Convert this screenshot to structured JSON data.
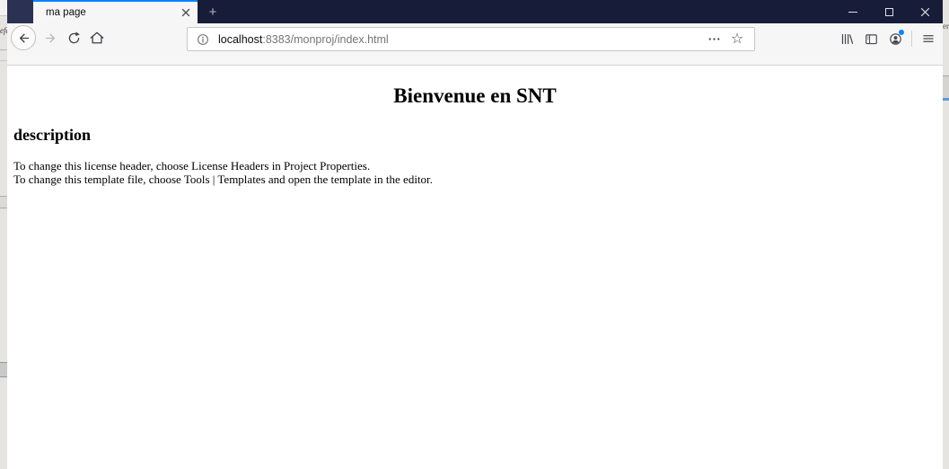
{
  "browser": {
    "tab_bar": {
      "active_tab_title": "ma page",
      "close_tab_glyph": "✕",
      "new_tab_glyph": "+"
    },
    "window_controls": {
      "minimize": "minimize",
      "maximize": "maximize",
      "close": "close"
    },
    "urlbar": {
      "host": "localhost",
      "path": ":8383/monproj/index.html",
      "bookmark_star_glyph": "☆"
    }
  },
  "page": {
    "title": "Bienvenue en SNT",
    "section_heading": "description",
    "paragraph_lines": [
      "To change this license header, choose License Headers in Project Properties.",
      "To change this template file, choose Tools | Templates and open the template in the editor."
    ]
  },
  "background_windows": {
    "left_edge_text": "efa",
    "right_edge_text": "er"
  },
  "colors": {
    "titlebar_bg": "#171c38",
    "titlebar_spacer": "#2b3153",
    "tab_accent_blue": "#0a84ff",
    "toolbar_bg": "#f6f6f7",
    "account_badge_blue": "#0a84ff",
    "url_host_color": "#0c0c0d",
    "url_path_color": "#757575",
    "icon_color": "#47484d",
    "disabled_icon_color": "#b8b8ba"
  },
  "icons": {
    "back": "left-arrow-in-circle",
    "forward": "right-arrow (disabled)",
    "reload": "circular-arrow",
    "home": "house-outline",
    "info": "i-in-circle",
    "page_actions": "three-dots",
    "bookmark": "star-outline",
    "library": "books-on-shelf",
    "sidebar": "panel-rectangle",
    "account": "person-in-circle with blue dot",
    "menu": "hamburger-three-lines"
  }
}
